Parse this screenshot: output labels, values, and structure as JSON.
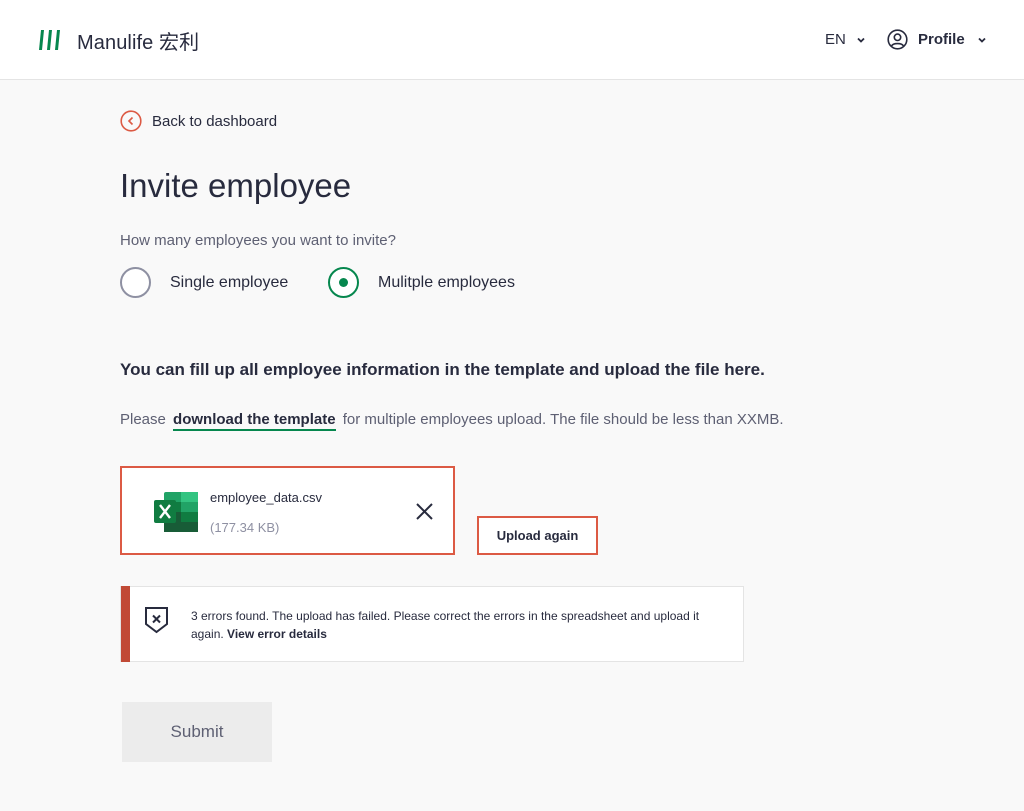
{
  "header": {
    "brand": "Manulife 宏利",
    "language": "EN",
    "profile_label": "Profile"
  },
  "back_label": "Back to dashboard",
  "page_title": "Invite employee",
  "question": "How many employees you want to invite?",
  "options": {
    "single": {
      "label": "Single employee",
      "selected": false
    },
    "multiple": {
      "label": "Mulitple employees",
      "selected": true
    }
  },
  "instruction": "You can fill up all employee information in the template and upload the file here.",
  "template_text": {
    "before": "Please",
    "link": "download the template",
    "after": "for multiple employees upload. The file should be less than XXMB."
  },
  "file": {
    "name": "employee_data.csv",
    "size": "(177.34 KB)"
  },
  "upload_again_label": "Upload again",
  "error": {
    "message": "3 errors found. The upload has failed. Please correct the errors in the spreadsheet and upload it again.",
    "link": "View error details"
  },
  "submit_label": "Submit",
  "colors": {
    "brand_green": "#06874e",
    "error_red": "#dc5a44",
    "error_bar": "#c14a36",
    "text_dark": "#282b3e"
  }
}
